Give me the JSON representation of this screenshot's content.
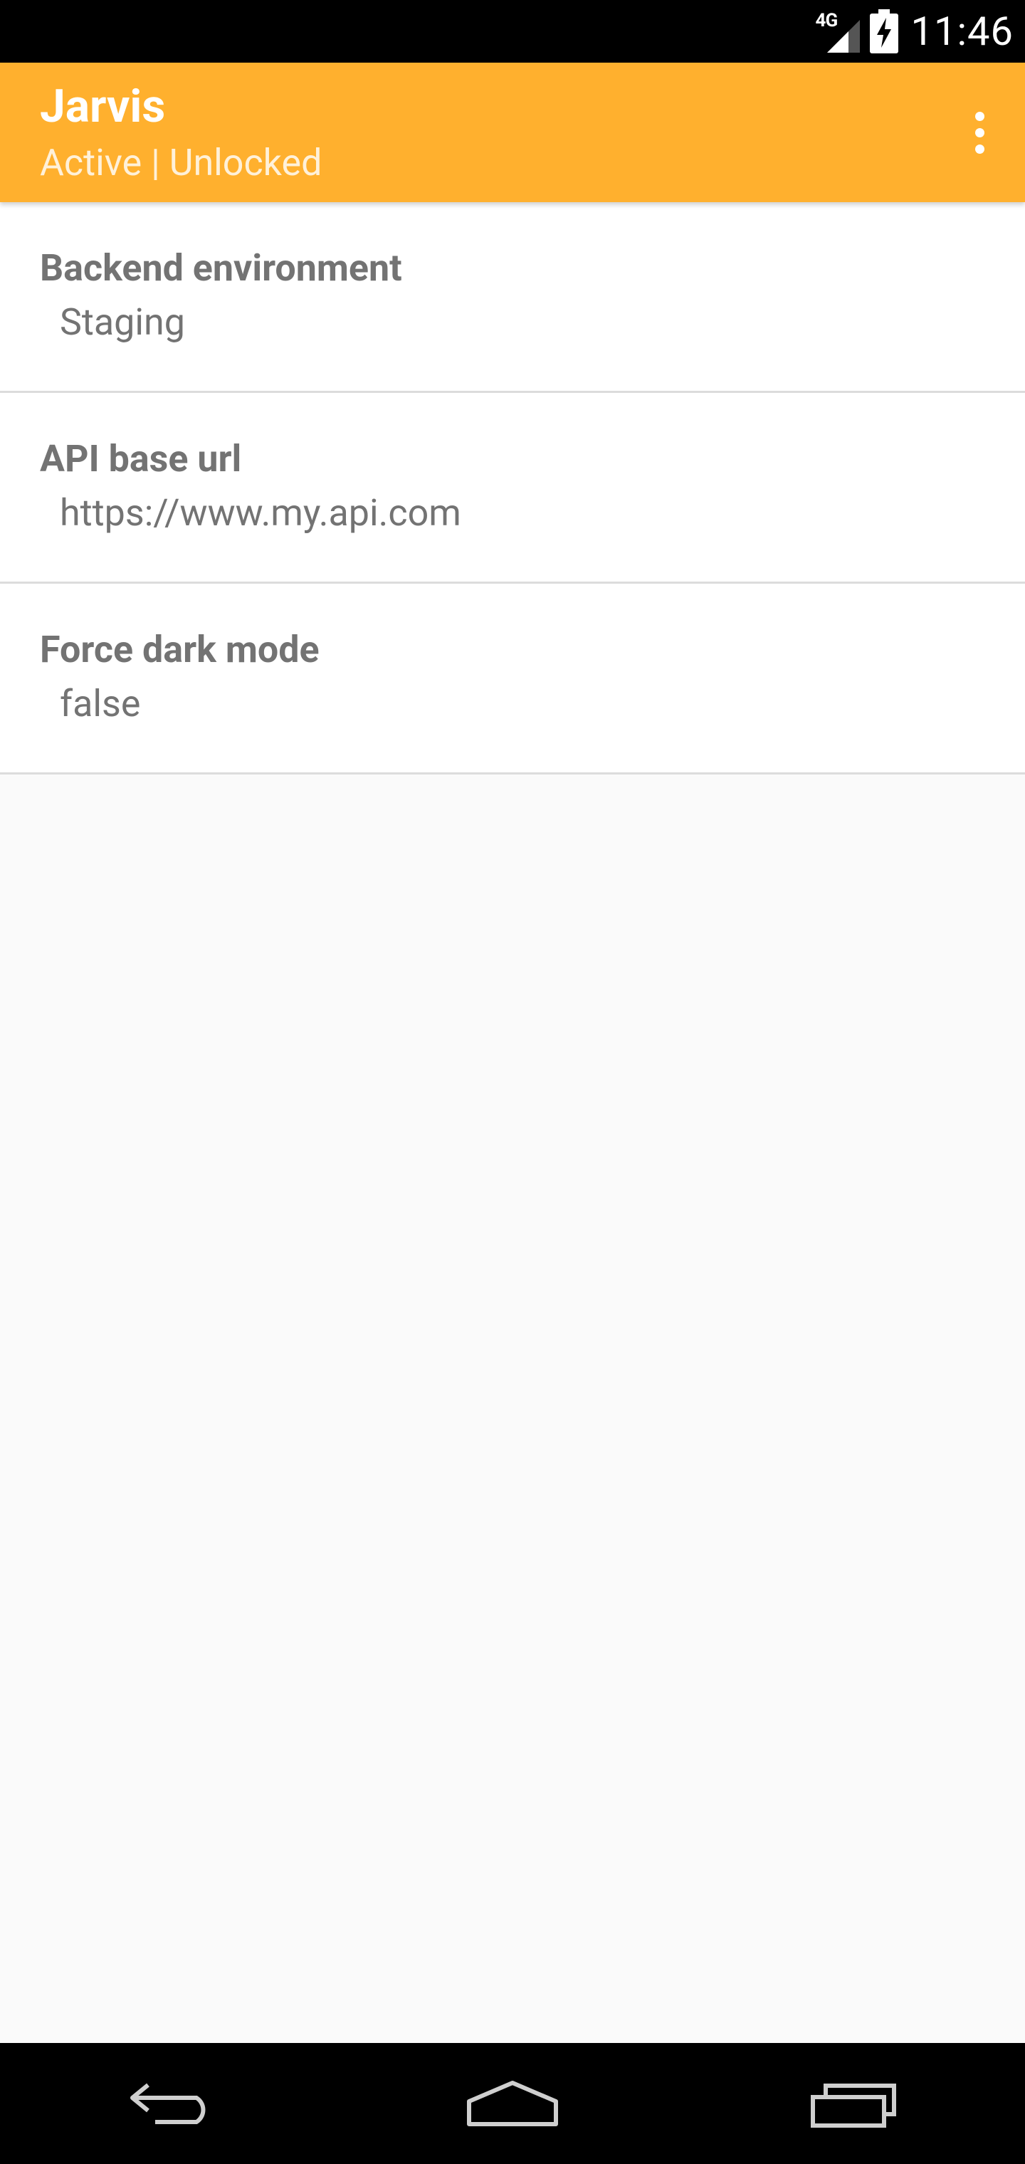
{
  "status_bar": {
    "network": "4G",
    "time": "11:46"
  },
  "action_bar": {
    "title": "Jarvis",
    "subtitle": "Active | Unlocked"
  },
  "settings": [
    {
      "title": "Backend environment",
      "value": "Staging"
    },
    {
      "title": "API base url",
      "value": "https://www.my.api.com"
    },
    {
      "title": "Force dark mode",
      "value": "false"
    }
  ],
  "icons": {
    "signal": "signal-icon",
    "battery": "battery-charging-icon",
    "overflow": "more-vert-icon",
    "back": "back-icon",
    "home": "home-icon",
    "recents": "recents-icon"
  },
  "colors": {
    "accent": "#ffb02e",
    "text": "#737373",
    "background": "#fafafa"
  }
}
